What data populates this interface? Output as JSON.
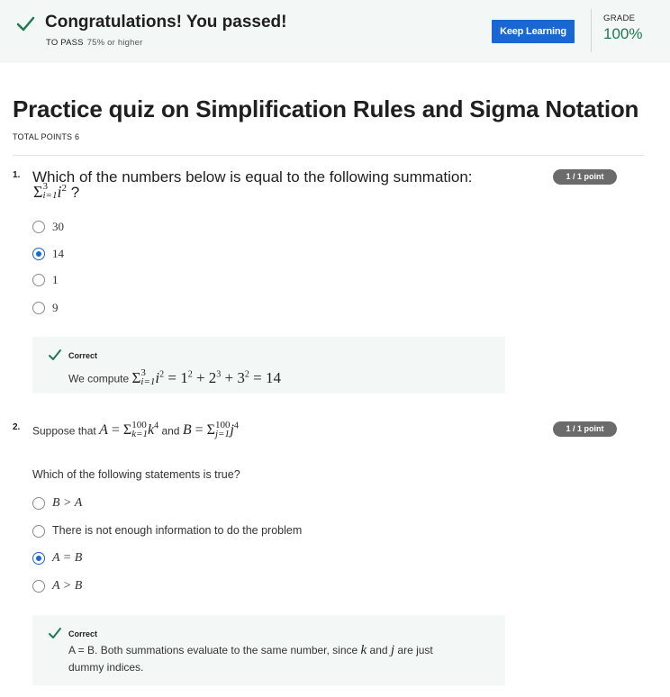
{
  "banner": {
    "title": "Congratulations! You passed!",
    "to_pass_label": "TO PASS",
    "to_pass_req": "75% or higher",
    "keep_learning": "Keep Learning",
    "grade_label": "GRADE",
    "grade_value": "100%",
    "icon": "check-icon"
  },
  "quiz": {
    "title": "Practice quiz on Simplification Rules and Sigma Notation",
    "total_points": "TOTAL POINTS 6"
  },
  "questions": [
    {
      "number": "1.",
      "text": "Which of the numbers below is equal to the following summation:",
      "math": {
        "sigma": "Σ",
        "upper": "3",
        "lower": "i=1",
        "term": "i",
        "exp": "2",
        "end": " ?"
      },
      "points": "1 / 1 point",
      "options": [
        "30",
        "14",
        "1",
        "9"
      ],
      "selected_index": 1,
      "feedback": {
        "label": "Correct",
        "prefix": "We compute ",
        "math": {
          "sigma": "Σ",
          "upper": "3",
          "lower": "i=1",
          "term": "i",
          "exp": "2",
          "rest": " = 1",
          "e1": "2",
          "p1": " + 2",
          "e2": "3",
          "p2": " + 3",
          "e3": "2",
          "result": " = 14"
        }
      }
    },
    {
      "number": "2.",
      "text_prefix": "Suppose that ",
      "text_mid": " and ",
      "math_a": {
        "var": "A",
        "eq": " = ",
        "sigma": "Σ",
        "upper": "100",
        "lower": "k=1",
        "term": "k",
        "exp": "4"
      },
      "math_b": {
        "var": "B",
        "eq": " = ",
        "sigma": "Σ",
        "upper": "100",
        "lower": "j=1",
        "term": "j",
        "exp": "4"
      },
      "sub_text": "Which of the following statements is true?",
      "points": "1 / 1 point",
      "options": [
        "B > A",
        "There is not enough information to do the problem",
        "A = B",
        "A > B"
      ],
      "selected_index": 2,
      "feedback": {
        "label": "Correct",
        "line1_a": "A = B. Both summations evaluate to the same number, since ",
        "var_k": "k",
        "line1_b": " and ",
        "var_j": "j",
        "line1_c": " are just",
        "line2": "dummy indices."
      }
    }
  ],
  "colors": {
    "accent": "#1a66d3",
    "success": "#1f7a52",
    "banner_bg": "#f3f8f6",
    "badge": "#6b6b6b"
  }
}
